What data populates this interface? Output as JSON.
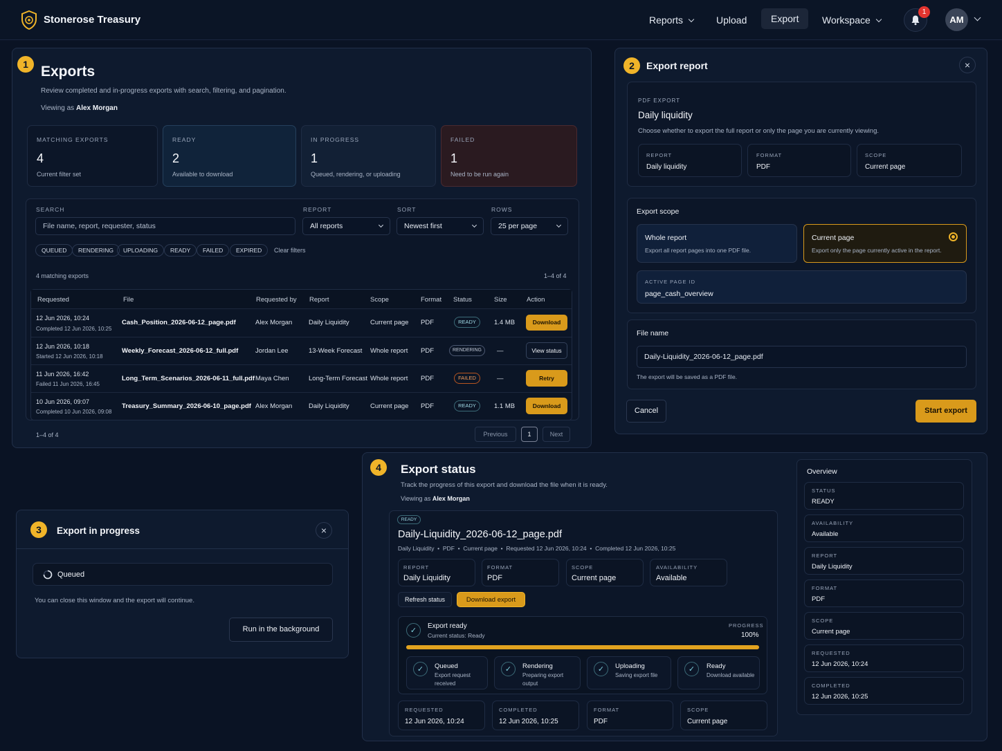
{
  "app": {
    "brand": "Stonerose Treasury",
    "nav": {
      "reports": "Reports",
      "upload": "Upload",
      "export": "Export",
      "workspace": "Workspace"
    },
    "notifications": "1",
    "avatar": "AM"
  },
  "exports": {
    "num": "1",
    "title": "Exports",
    "subtitle": "Review completed and in-progress exports with search, filtering, and pagination.",
    "viewing_prefix": "Viewing as",
    "viewer": "Alex Morgan",
    "stats": [
      {
        "label": "MATCHING EXPORTS",
        "value": "4",
        "note": "Current filter set"
      },
      {
        "label": "READY",
        "value": "2",
        "note": "Available to download"
      },
      {
        "label": "IN PROGRESS",
        "value": "1",
        "note": "Queued, rendering, or uploading"
      },
      {
        "label": "FAILED",
        "value": "1",
        "note": "Need to be run again"
      }
    ],
    "filters": {
      "search_label": "SEARCH",
      "search_placeholder": "File name, report, requester, status",
      "report_label": "REPORT",
      "report_value": "All reports",
      "sort_label": "SORT",
      "sort_value": "Newest first",
      "rows_label": "ROWS",
      "rows_value": "25 per page"
    },
    "chips": [
      "QUEUED",
      "RENDERING",
      "UPLOADING",
      "READY",
      "FAILED",
      "EXPIRED"
    ],
    "clear": "Clear filters",
    "count_text": "4 matching exports",
    "range_text": "1–4 of 4",
    "columns": [
      "Requested",
      "File",
      "Requested by",
      "Report",
      "Scope",
      "Format",
      "Status",
      "Size",
      "Action"
    ],
    "rows": [
      {
        "req": "12 Jun 2026, 10:24",
        "req2": "Completed 12 Jun 2026, 10:25",
        "file": "Cash_Position_2026-06-12_page.pdf",
        "by": "Alex Morgan",
        "report": "Daily Liquidity",
        "scope": "Current page",
        "format": "PDF",
        "status": "READY",
        "size": "1.4 MB",
        "action": "Download"
      },
      {
        "req": "12 Jun 2026, 10:18",
        "req2": "Started 12 Jun 2026, 10:18",
        "file": "Weekly_Forecast_2026-06-12_full.pdf",
        "by": "Jordan Lee",
        "report": "13-Week Forecast",
        "scope": "Whole report",
        "format": "PDF",
        "status": "RENDERING",
        "size": "—",
        "action": "View status"
      },
      {
        "req": "11 Jun 2026, 16:42",
        "req2": "Failed 11 Jun 2026, 16:45",
        "file": "Long_Term_Scenarios_2026-06-11_full.pdf",
        "by": "Maya Chen",
        "report": "Long-Term Forecast",
        "scope": "Whole report",
        "format": "PDF",
        "status": "FAILED",
        "size": "—",
        "action": "Retry"
      },
      {
        "req": "10 Jun 2026, 09:07",
        "req2": "Completed 10 Jun 2026, 09:08",
        "file": "Treasury_Summary_2026-06-10_page.pdf",
        "by": "Alex Morgan",
        "report": "Daily Liquidity",
        "scope": "Current page",
        "format": "PDF",
        "status": "READY",
        "size": "1.1 MB",
        "action": "Download"
      }
    ],
    "pager": {
      "range": "1–4 of 4",
      "prev": "Previous",
      "page": "1",
      "next": "Next"
    }
  },
  "export_report": {
    "num": "2",
    "title": "Export report",
    "kicker": "PDF EXPORT",
    "report_name": "Daily liquidity",
    "desc": "Choose whether to export the full report or only the page you are currently viewing.",
    "meta": [
      {
        "label": "REPORT",
        "value": "Daily liquidity"
      },
      {
        "label": "FORMAT",
        "value": "PDF"
      },
      {
        "label": "SCOPE",
        "value": "Current page"
      }
    ],
    "scope_title": "Export scope",
    "whole_title": "Whole report",
    "whole_desc": "Export all report pages into one PDF file.",
    "current_title": "Current page",
    "current_desc": "Export only the page currently active in the report.",
    "page_id_label": "ACTIVE PAGE ID",
    "page_id": "page_cash_overview",
    "file_label": "File name",
    "file_value": "Daily-Liquidity_2026-06-12_page.pdf",
    "file_note": "The export will be saved as a PDF file.",
    "cancel": "Cancel",
    "start": "Start export"
  },
  "progress_modal": {
    "num": "3",
    "title": "Export in progress",
    "status": "Queued",
    "note": "You can close this window and the export will continue.",
    "bg_button": "Run in the background"
  },
  "export_status": {
    "num": "4",
    "title": "Export status",
    "subtitle": "Track the progress of this export and download the file when it is ready.",
    "viewing_prefix": "Viewing as",
    "viewer": "Alex Morgan",
    "badge": "READY",
    "file": "Daily-Liquidity_2026-06-12_page.pdf",
    "meta_line": [
      "Daily Liquidity",
      "PDF",
      "Current page",
      "Requested 12 Jun 2026, 10:24",
      "Completed 12 Jun 2026, 10:25"
    ],
    "tiles": [
      {
        "label": "REPORT",
        "value": "Daily Liquidity"
      },
      {
        "label": "FORMAT",
        "value": "PDF"
      },
      {
        "label": "SCOPE",
        "value": "Current page"
      },
      {
        "label": "AVAILABILITY",
        "value": "Available"
      }
    ],
    "refresh": "Refresh status",
    "download": "Download export",
    "ready_title": "Export ready",
    "ready_sub": "Current status: Ready",
    "progress_label": "PROGRESS",
    "progress_text": "100%",
    "progress": 1.0,
    "steps": [
      {
        "title": "Queued",
        "desc": "Export request received"
      },
      {
        "title": "Rendering",
        "desc": "Preparing export output"
      },
      {
        "title": "Uploading",
        "desc": "Saving export file"
      },
      {
        "title": "Ready",
        "desc": "Download available"
      }
    ],
    "bottom": [
      {
        "label": "REQUESTED",
        "value": "12 Jun 2026, 10:24"
      },
      {
        "label": "COMPLETED",
        "value": "12 Jun 2026, 10:25"
      },
      {
        "label": "FORMAT",
        "value": "PDF"
      },
      {
        "label": "SCOPE",
        "value": "Current page"
      }
    ],
    "overview_title": "Overview",
    "overview": [
      {
        "label": "STATUS",
        "value": "READY"
      },
      {
        "label": "AVAILABILITY",
        "value": "Available"
      },
      {
        "label": "REPORT",
        "value": "Daily Liquidity"
      },
      {
        "label": "FORMAT",
        "value": "PDF"
      },
      {
        "label": "SCOPE",
        "value": "Current page"
      },
      {
        "label": "REQUESTED",
        "value": "12 Jun 2026, 10:24"
      },
      {
        "label": "COMPLETED",
        "value": "12 Jun 2026, 10:25"
      }
    ]
  },
  "colors": {
    "accent": "#f0b429",
    "bg": "#0a1324",
    "ready": "#9fd9e5",
    "failed": "#f39c5b"
  }
}
